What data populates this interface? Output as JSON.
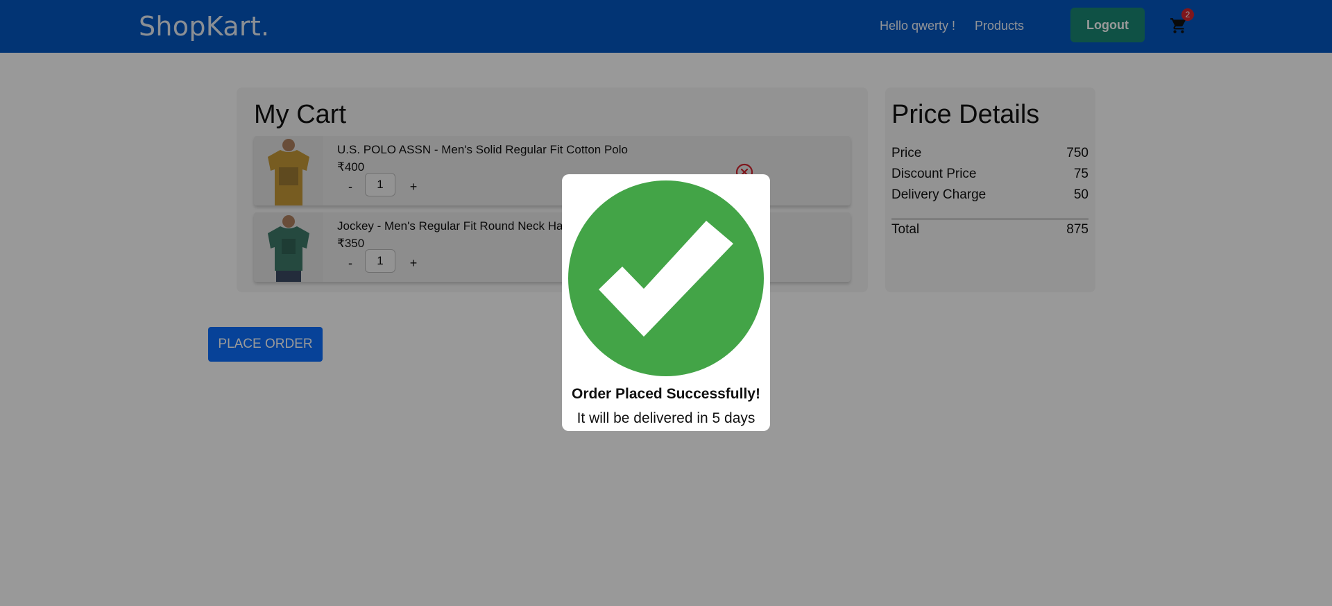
{
  "navbar": {
    "brand": "ShopKart.",
    "greeting": "Hello qwerty !",
    "products_label": "Products",
    "logout_label": "Logout",
    "cart_count": "2",
    "cart_icon": "shopping-cart-icon"
  },
  "cart": {
    "title": "My Cart",
    "items": [
      {
        "name": "U.S. POLO ASSN - Men's Solid Regular Fit Cotton Polo",
        "price": "₹400",
        "quantity": "1",
        "minus_label": "-",
        "plus_label": "+",
        "image_color": "#c79a38"
      },
      {
        "name": "Jockey - Men's Regular Fit Round Neck Ha",
        "price": "₹350",
        "quantity": "1",
        "minus_label": "-",
        "plus_label": "+",
        "image_color": "#3e7a6a"
      }
    ],
    "remove_icon": "close-circle-icon"
  },
  "price_details": {
    "title": "Price Details",
    "rows": [
      {
        "label": "Price",
        "value": "750"
      },
      {
        "label": "Discount Price",
        "value": "75"
      },
      {
        "label": "Delivery Charge",
        "value": "50"
      }
    ],
    "total_label": "Total",
    "total_value": "875"
  },
  "actions": {
    "place_order_label": "PLACE ORDER"
  },
  "modal": {
    "title": "Order Placed Successfully!",
    "subtitle": "It will be delivered in 5 days",
    "icon": "success-check-icon",
    "icon_color": "#43a447"
  },
  "colors": {
    "navbar": "#0458c1",
    "logout": "#198774",
    "primary": "#0d6efd",
    "badge": "#d4252f"
  }
}
